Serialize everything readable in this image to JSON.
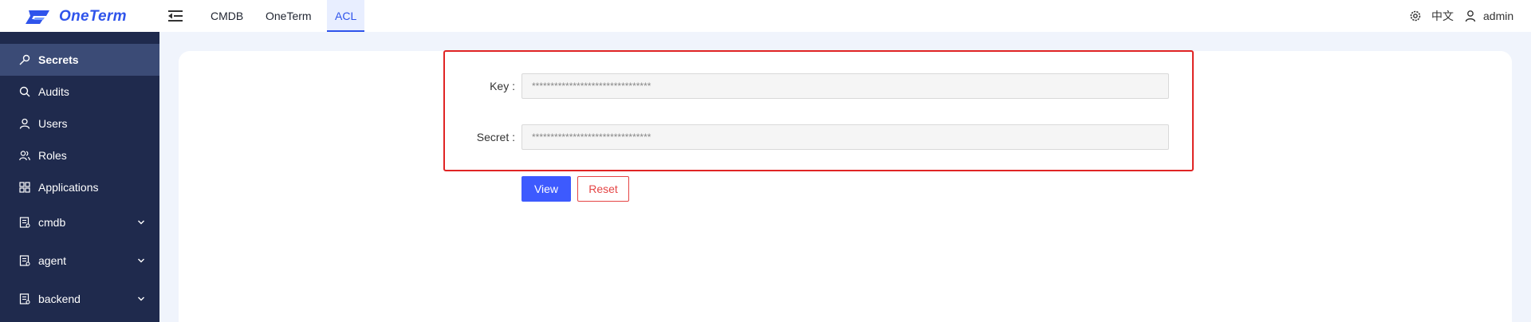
{
  "app": {
    "name": "OneTerm"
  },
  "header": {
    "tabs": [
      {
        "label": "CMDB",
        "active": false
      },
      {
        "label": "OneTerm",
        "active": false
      },
      {
        "label": "ACL",
        "active": true
      }
    ],
    "language": "中文",
    "user": "admin",
    "icons": {
      "menu": "menu-fold-icon",
      "settings": "gear-icon",
      "user": "user-icon"
    }
  },
  "sidebar": {
    "items": [
      {
        "label": "Secrets",
        "icon": "key-icon",
        "active": true
      },
      {
        "label": "Audits",
        "icon": "search-icon"
      },
      {
        "label": "Users",
        "icon": "user-icon"
      },
      {
        "label": "Roles",
        "icon": "users-icon"
      },
      {
        "label": "Applications",
        "icon": "apps-icon"
      },
      {
        "label": "cmdb",
        "icon": "doc-icon",
        "expandable": true
      },
      {
        "label": "agent",
        "icon": "doc-icon",
        "expandable": true
      },
      {
        "label": "backend",
        "icon": "doc-icon",
        "expandable": true
      }
    ]
  },
  "form": {
    "key": {
      "label": "Key",
      "value": "********************************"
    },
    "secret": {
      "label": "Secret",
      "value": "********************************"
    },
    "view_label": "View",
    "reset_label": "Reset"
  },
  "colors": {
    "accent": "#3d5afe",
    "sidebar": "#1f2a4d",
    "highlight": "#e02424",
    "danger": "#e54545"
  }
}
